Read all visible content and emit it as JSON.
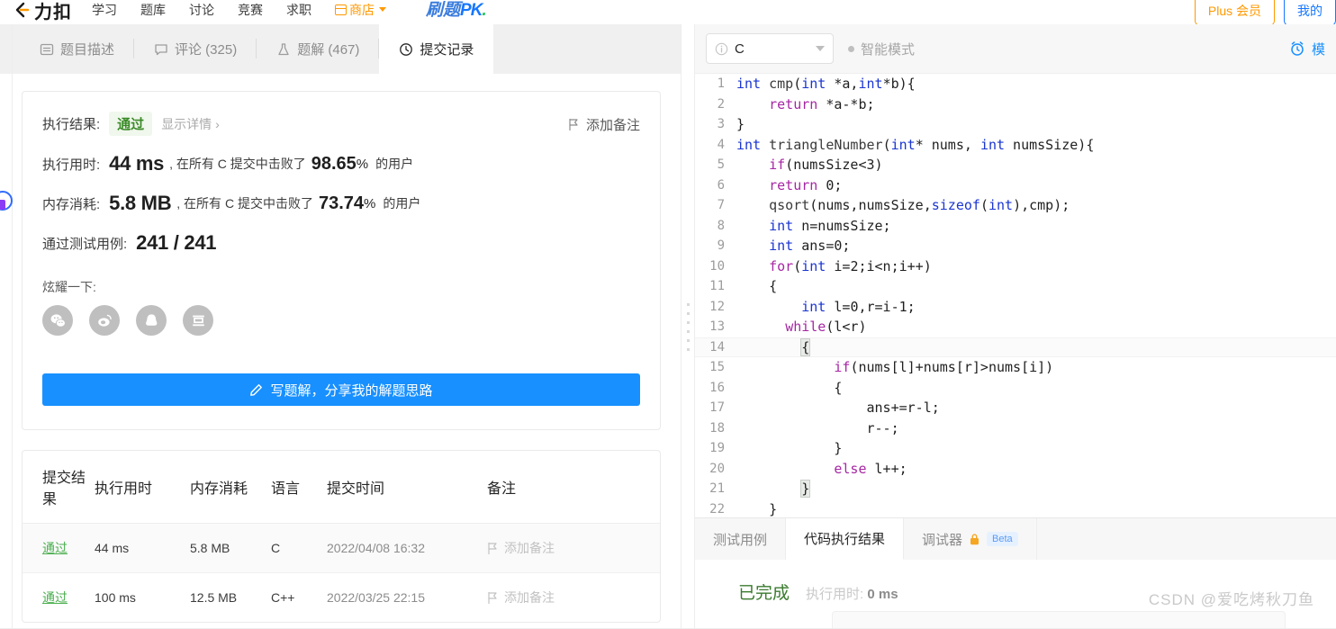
{
  "topnav": {
    "logo_text": "力扣",
    "items": [
      {
        "label": "学习"
      },
      {
        "label": "题库"
      },
      {
        "label": "讨论"
      },
      {
        "label": "竞赛"
      },
      {
        "label": "求职"
      },
      {
        "label": "商店"
      }
    ],
    "pk_cn": "刷题",
    "pk_en": "PK",
    "pk_dot": ".",
    "plus_label": "Plus 会员",
    "blue_btn_label": "我的"
  },
  "tabs": [
    {
      "label": "题目描述",
      "icon": "document-icon",
      "active": false
    },
    {
      "label": "评论 (325)",
      "icon": "comment-icon",
      "active": false
    },
    {
      "label": "题解 (467)",
      "icon": "flask-icon",
      "active": false
    },
    {
      "label": "提交记录",
      "icon": "clock-icon",
      "active": true
    }
  ],
  "result": {
    "exec_result_label": "执行结果:",
    "status": "通过",
    "show_detail": "显示详情 ›",
    "add_note": "添加备注",
    "runtime_label": "执行用时:",
    "runtime_value": "44 ms",
    "runtime_mid": ", 在所有 C 提交中击败了",
    "runtime_pct": "98.65",
    "pct_sign": "%",
    "runtime_suffix": "的用户",
    "memory_label": "内存消耗:",
    "memory_value": "5.8 MB",
    "memory_mid": ", 在所有 C 提交中击败了",
    "memory_pct": "73.74",
    "memory_suffix": "的用户",
    "testcases_label": "通过测试用例:",
    "testcases_value": "241 / 241",
    "flaunt_label": "炫耀一下:",
    "share_icons": [
      "wechat-icon",
      "weibo-icon",
      "qq-icon",
      "douban-icon"
    ],
    "cta_label": "写题解，分享我的解题思路"
  },
  "table": {
    "headers": [
      "提交结果",
      "执行用时",
      "内存消耗",
      "语言",
      "提交时间",
      "备注"
    ],
    "rows": [
      {
        "status": "通过",
        "runtime": "44 ms",
        "memory": "5.8 MB",
        "lang": "C",
        "time": "2022/04/08 16:32",
        "note": "添加备注"
      },
      {
        "status": "通过",
        "runtime": "100 ms",
        "memory": "12.5 MB",
        "lang": "C++",
        "time": "2022/03/25 22:15",
        "note": "添加备注"
      }
    ]
  },
  "editor": {
    "language": "C",
    "smart_mode": "智能模式",
    "timer_label": "模",
    "lines": [
      {
        "n": "1",
        "text": "int cmp(int *a,int*b){"
      },
      {
        "n": "2",
        "text": "    return *a-*b;"
      },
      {
        "n": "3",
        "text": "}"
      },
      {
        "n": "4",
        "text": "int triangleNumber(int* nums, int numsSize){"
      },
      {
        "n": "5",
        "text": "    if(numsSize<3)"
      },
      {
        "n": "6",
        "text": "    return 0;"
      },
      {
        "n": "7",
        "text": "    qsort(nums,numsSize,sizeof(int),cmp);"
      },
      {
        "n": "8",
        "text": "    int n=numsSize;"
      },
      {
        "n": "9",
        "text": "    int ans=0;"
      },
      {
        "n": "10",
        "text": "    for(int i=2;i<n;i++)"
      },
      {
        "n": "11",
        "text": "    {"
      },
      {
        "n": "12",
        "text": "        int l=0,r=i-1;"
      },
      {
        "n": "13",
        "text": "      while(l<r)"
      },
      {
        "n": "14",
        "text": "        {"
      },
      {
        "n": "15",
        "text": "            if(nums[l]+nums[r]>nums[i])"
      },
      {
        "n": "16",
        "text": "            {"
      },
      {
        "n": "17",
        "text": "                ans+=r-l;"
      },
      {
        "n": "18",
        "text": "                r--;"
      },
      {
        "n": "19",
        "text": "            }"
      },
      {
        "n": "20",
        "text": "            else l++;"
      },
      {
        "n": "21",
        "text": "        }"
      },
      {
        "n": "22",
        "text": "    }"
      }
    ]
  },
  "bottom": {
    "tabs": [
      {
        "label": "测试用例",
        "active": false
      },
      {
        "label": "代码执行结果",
        "active": true
      },
      {
        "label": "调试器",
        "active": false,
        "badge": "Beta",
        "icon": "lock-icon"
      }
    ],
    "done_label": "已完成",
    "exec_prefix": "执行用时:",
    "exec_value": "0 ms"
  },
  "watermark": "CSDN @爱吃烤秋刀鱼",
  "colors": {
    "accent_blue": "#1890ff",
    "pass_green": "#4caf50",
    "orange": "#f90",
    "keyword_blue": "#1a35d1",
    "keyword_purple": "#a626a4"
  }
}
